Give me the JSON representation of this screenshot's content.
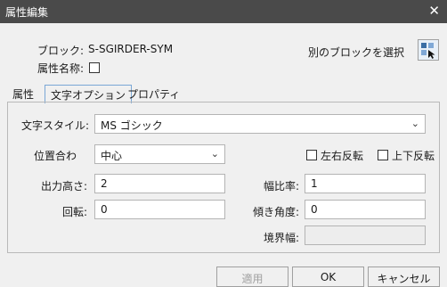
{
  "window": {
    "title": "属性編集"
  },
  "header": {
    "block_label": "ブロック:",
    "block_value": "S-SGIRDER-SYM",
    "attr_name_label": "属性名称:",
    "select_block_label": "別のブロックを選択"
  },
  "tabs": [
    {
      "label": "属性"
    },
    {
      "label": "文字オプション"
    },
    {
      "label": "プロパティ"
    }
  ],
  "options": {
    "text_style_label": "文字スタイル:",
    "text_style_value": "MS ゴシック",
    "justify_label": "位置合わ",
    "justify_value": "中心",
    "mirror_lr_label": "左右反転",
    "mirror_ud_label": "上下反転",
    "height_label": "出力高さ:",
    "height_value": "2",
    "width_factor_label": "幅比率:",
    "width_factor_value": "1",
    "rotation_label": "回転:",
    "rotation_value": "0",
    "oblique_label": "傾き角度:",
    "oblique_value": "0",
    "boundary_label": "境界幅:",
    "boundary_value": ""
  },
  "buttons": {
    "apply": "適用",
    "ok": "OK",
    "cancel": "キャンセル"
  },
  "icons": {
    "close": "close-icon",
    "pick": "pick-block-icon",
    "dropdown": "chevron-down-icon"
  }
}
